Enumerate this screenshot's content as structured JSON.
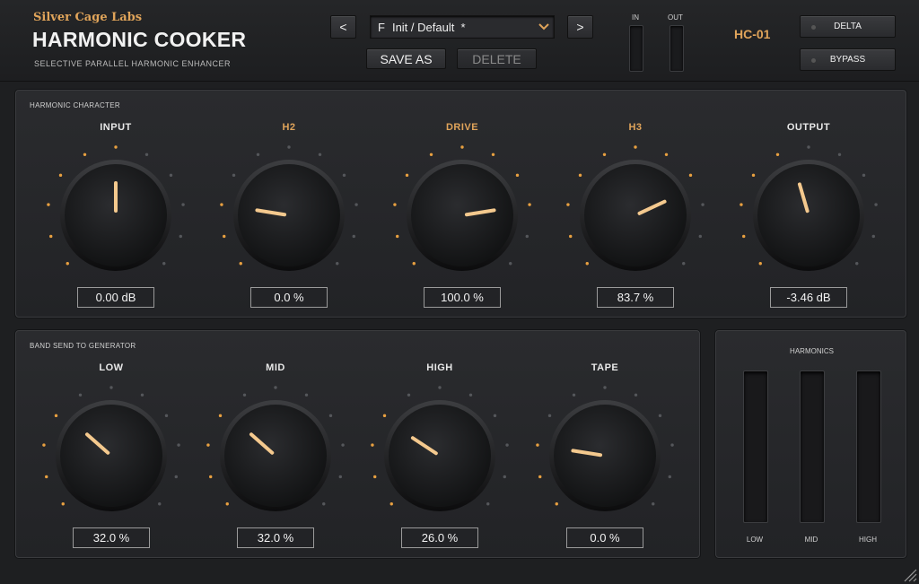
{
  "header": {
    "brand": "Silver Cage Labs",
    "title": "HARMONIC COOKER",
    "subtitle": "SELECTIVE PARALLEL HARMONIC ENHANCER",
    "prev_label": "<",
    "next_label": ">",
    "preset_prefix": "F",
    "preset_name": "Init / Default  *",
    "save_label": "SAVE AS",
    "delete_label": "DELETE",
    "meter_in_label": "IN",
    "meter_out_label": "OUT",
    "model": "HC-01",
    "delta_label": "DELTA",
    "bypass_label": "BYPASS"
  },
  "character": {
    "title": "HARMONIC CHARACTER",
    "knobs": [
      {
        "label": "INPUT",
        "value": "0.00 dB",
        "fraction": 0.5,
        "highlight": false
      },
      {
        "label": "H2",
        "value": "0.0 %",
        "fraction": 0.2,
        "highlight": true
      },
      {
        "label": "DRIVE",
        "value": "100.0 %",
        "fraction": 0.8,
        "highlight": true
      },
      {
        "label": "H3",
        "value": "83.7 %",
        "fraction": 0.74,
        "highlight": true
      },
      {
        "label": "OUTPUT",
        "value": "-3.46 dB",
        "fraction": 0.44,
        "highlight": false
      }
    ]
  },
  "send": {
    "title": "BAND SEND TO GENERATOR",
    "knobs": [
      {
        "label": "LOW",
        "value": "32.0 %",
        "fraction": 0.32,
        "highlight": false
      },
      {
        "label": "MID",
        "value": "32.0 %",
        "fraction": 0.32,
        "highlight": false
      },
      {
        "label": "HIGH",
        "value": "26.0 %",
        "fraction": 0.29,
        "highlight": false
      },
      {
        "label": "TAPE",
        "value": "0.0 %",
        "fraction": 0.2,
        "highlight": false
      }
    ]
  },
  "harmonics": {
    "title": "HARMONICS",
    "bands": [
      "LOW",
      "MID",
      "HIGH"
    ]
  },
  "colors": {
    "accent": "#e0a45a",
    "pointer": "#f4c98e",
    "dot_lit": "#e8a040",
    "dot_off": "#55575b"
  }
}
